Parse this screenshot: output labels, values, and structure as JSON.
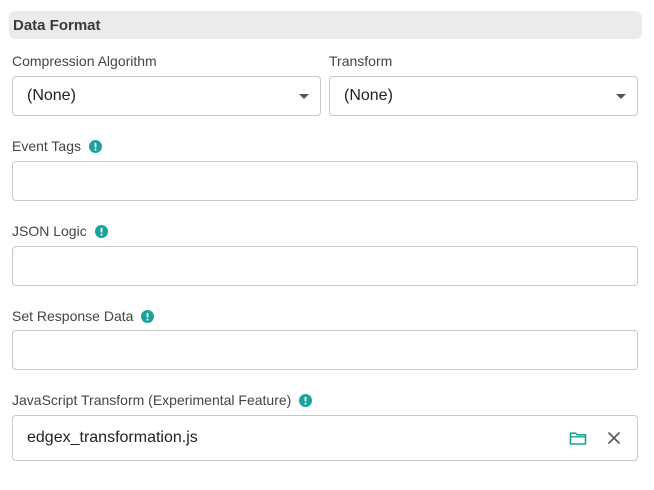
{
  "section": {
    "title": "Data Format"
  },
  "compression": {
    "label": "Compression Algorithm",
    "value": "(None)"
  },
  "transform": {
    "label": "Transform",
    "value": "(None)"
  },
  "event_tags": {
    "label": "Event Tags",
    "value": ""
  },
  "json_logic": {
    "label": "JSON Logic",
    "value": ""
  },
  "response_data": {
    "label": "Set Response Data",
    "value": ""
  },
  "js_transform": {
    "label": "JavaScript Transform (Experimental Feature)",
    "file_name": "edgex_transformation.js"
  },
  "colors": {
    "accent": "#1ba39a",
    "header_bg": "#e9ebed",
    "border": "#c6c8cb"
  },
  "icons": [
    "info-icon",
    "caret-down-icon",
    "folder-icon",
    "close-icon"
  ]
}
